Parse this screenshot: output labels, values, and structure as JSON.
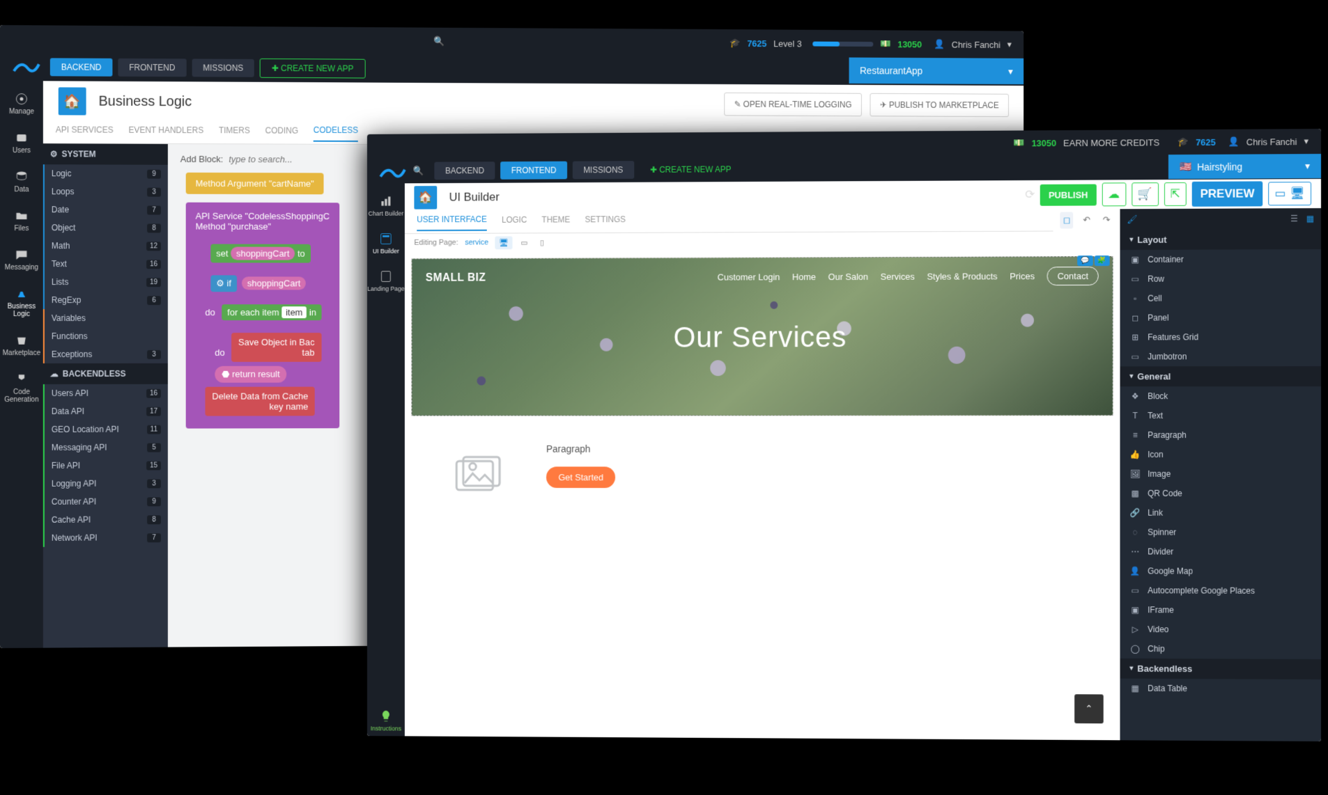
{
  "backWindow": {
    "top": {
      "points": "7625",
      "level": "Level 3",
      "credits": "13050",
      "user": "Chris Fanchi"
    },
    "tabs": {
      "backend": "BACKEND",
      "frontend": "FRONTEND",
      "missions": "MISSIONS",
      "create": "CREATE NEW APP"
    },
    "appSelect": "RestaurantApp",
    "page": {
      "title": "Business Logic",
      "openLog": "OPEN REAL-TIME LOGGING",
      "publish": "PUBLISH TO MARKETPLACE"
    },
    "leftnav": [
      "Manage",
      "Users",
      "Data",
      "Files",
      "Messaging",
      "Business Logic",
      "Marketplace",
      "Code Generation"
    ],
    "subtabs": [
      "API SERVICES",
      "EVENT HANDLERS",
      "TIMERS",
      "CODING",
      "CODELESS"
    ],
    "subtabsActive": 4,
    "tree": {
      "systemHeader": "SYSTEM",
      "system": [
        {
          "n": "Logic",
          "c": 9,
          "cls": "bl"
        },
        {
          "n": "Loops",
          "c": 3,
          "cls": "bl"
        },
        {
          "n": "Date",
          "c": 7,
          "cls": "bl"
        },
        {
          "n": "Object",
          "c": 8,
          "cls": "bl"
        },
        {
          "n": "Math",
          "c": 12,
          "cls": "bl"
        },
        {
          "n": "Text",
          "c": 16,
          "cls": "bl"
        },
        {
          "n": "Lists",
          "c": 19,
          "cls": "bl"
        },
        {
          "n": "RegExp",
          "c": 6,
          "cls": "bl"
        },
        {
          "n": "Variables",
          "c": "",
          "cls": "or"
        },
        {
          "n": "Functions",
          "c": "",
          "cls": "or"
        },
        {
          "n": "Exceptions",
          "c": 3,
          "cls": "or"
        }
      ],
      "backendlessHeader": "BACKENDLESS",
      "backendless": [
        {
          "n": "Users API",
          "c": 16
        },
        {
          "n": "Data API",
          "c": 17
        },
        {
          "n": "GEO Location API",
          "c": 11
        },
        {
          "n": "Messaging API",
          "c": 5
        },
        {
          "n": "File API",
          "c": 15
        },
        {
          "n": "Logging API",
          "c": 3
        },
        {
          "n": "Counter API",
          "c": 9
        },
        {
          "n": "Cache API",
          "c": 8
        },
        {
          "n": "Network API",
          "c": 7
        }
      ]
    },
    "canvas": {
      "addBlockLabel": "Add Block:",
      "addBlockPH": "type to search...",
      "methodArg": "Method Argument \"cartName\"",
      "svcTitle": "API Service \"CodelessShoppingC",
      "svcMethod": "Method \"purchase\"",
      "setVar": "set",
      "shoppingCart": "shoppingCart",
      "to": "to",
      "if": "if",
      "do": "do",
      "forEach": "for each item",
      "item": "item",
      "in": "in",
      "saveObj": "Save Object in Bac",
      "tab": "tab",
      "return": "return result",
      "deleteCache": "Delete Data from Cache",
      "keyName": "key name"
    }
  },
  "frontWindow": {
    "top": {
      "credits": "13050",
      "earn": "EARN MORE CREDITS",
      "points": "7625",
      "user": "Chris Fanchi"
    },
    "tabs": {
      "backend": "BACKEND",
      "frontend": "FRONTEND",
      "missions": "MISSIONS",
      "create": "CREATE NEW APP"
    },
    "appSelect": "Hairstyling",
    "page": {
      "title": "UI Builder",
      "publish": "PUBLISH",
      "preview": "PREVIEW"
    },
    "leftnav": [
      "Chart Builder",
      "UI Builder",
      "Landing Page",
      "Instructions"
    ],
    "subtabs": [
      "USER INTERFACE",
      "LOGIC",
      "THEME",
      "SETTINGS"
    ],
    "editing": {
      "label": "Editing Page:",
      "value": "service"
    },
    "preview": {
      "brand": "SMALL BIZ",
      "nav": [
        "Customer Login",
        "Home",
        "Our Salon",
        "Services",
        "Styles & Products",
        "Prices",
        "Contact"
      ],
      "hero": "Our Services",
      "paragraph": "Paragraph",
      "getStarted": "Get Started"
    },
    "right": {
      "layoutHeader": "Layout",
      "layout": [
        "Container",
        "Row",
        "Cell",
        "Panel",
        "Features Grid",
        "Jumbotron"
      ],
      "generalHeader": "General",
      "general": [
        "Block",
        "Text",
        "Paragraph",
        "Icon",
        "Image",
        "QR Code",
        "Link",
        "Spinner",
        "Divider",
        "Google Map",
        "Autocomplete Google Places",
        "IFrame",
        "Video",
        "Chip"
      ],
      "backendlessHeader": "Backendless",
      "backendless": [
        "Data Table"
      ]
    }
  }
}
